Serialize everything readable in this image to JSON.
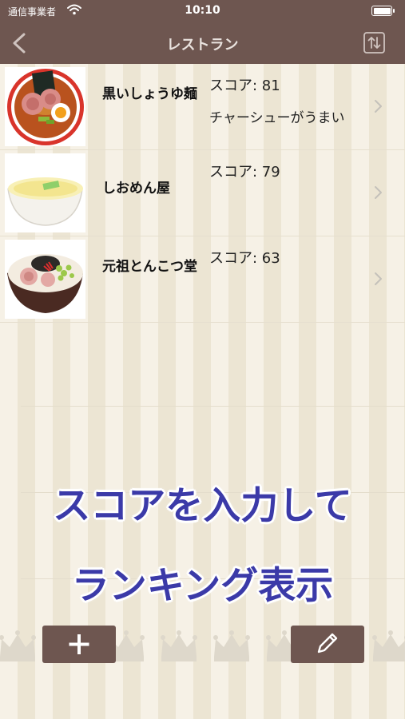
{
  "status_bar": {
    "carrier": "通信事業者",
    "time": "10:10"
  },
  "nav": {
    "title": "レストラン"
  },
  "restaurants": [
    {
      "name": "黒いしょうゆ麺",
      "score": "スコア: 81",
      "comment": "チャーシューがうまい",
      "image": "shoyu-ramen"
    },
    {
      "name": "しおめん屋",
      "score": "スコア: 79",
      "comment": "",
      "image": "shio-ramen"
    },
    {
      "name": "元祖とんこつ堂",
      "score": "スコア: 63",
      "comment": "",
      "image": "tonkotsu-ramen"
    }
  ],
  "promo": {
    "line1": "スコアを入力して",
    "line2": "ランキング表示"
  },
  "toolbar": {
    "add_icon": "plus-icon",
    "edit_icon": "pencil-icon"
  },
  "colors": {
    "bar": "#6e5650",
    "promo_text": "#3b3aa8",
    "background": "#f4efe3"
  }
}
